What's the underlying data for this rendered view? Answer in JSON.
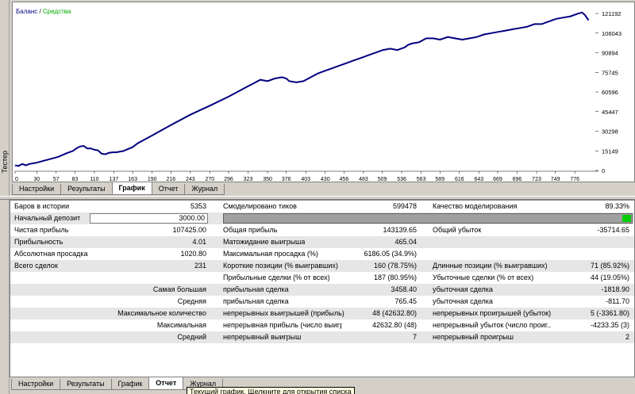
{
  "side_label": "Тестер",
  "chart": {
    "legend_balance": "Баланс",
    "legend_sep": " / ",
    "legend_equity": "Средства",
    "balance_color": "#000080",
    "equity_color": "#00aa00"
  },
  "chart_data": {
    "type": "line",
    "series": [
      {
        "name": "Баланс",
        "x": [
          0,
          5,
          10,
          15,
          20,
          25,
          30,
          40,
          50,
          60,
          70,
          75,
          80,
          85,
          90,
          95,
          100,
          105,
          110,
          115,
          120,
          125,
          130,
          135,
          140,
          150,
          163,
          170,
          190,
          216,
          243,
          270,
          296,
          323,
          330,
          340,
          350,
          360,
          370,
          376,
          380,
          390,
          400,
          410,
          420,
          430,
          440,
          450,
          460,
          470,
          480,
          490,
          500,
          510,
          520,
          530,
          540,
          545,
          550,
          560,
          570,
          580,
          589,
          600,
          610,
          620,
          630,
          640,
          650,
          660,
          670,
          680,
          690,
          700,
          710,
          720,
          730,
          740,
          750,
          760,
          770,
          780,
          786,
          790,
          795
        ],
        "values": [
          4000,
          3500,
          5000,
          4000,
          5000,
          5500,
          6000,
          7500,
          9000,
          10500,
          13000,
          14000,
          15000,
          17000,
          18500,
          19000,
          17000,
          17000,
          16000,
          15500,
          13000,
          12500,
          13500,
          14000,
          14000,
          15000,
          18000,
          21000,
          27000,
          35000,
          43000,
          50000,
          57000,
          65000,
          67000,
          70000,
          69000,
          71000,
          72000,
          71000,
          69000,
          68000,
          69000,
          72000,
          75000,
          77000,
          79000,
          81000,
          83000,
          85000,
          87000,
          89000,
          91000,
          93000,
          94000,
          93000,
          95000,
          97000,
          98000,
          99000,
          102000,
          102000,
          101000,
          103000,
          102000,
          101000,
          102000,
          103000,
          105000,
          106000,
          107000,
          108000,
          109000,
          110000,
          111000,
          113000,
          113000,
          115000,
          117000,
          118000,
          119000,
          121000,
          122000,
          120000,
          116000
        ]
      }
    ],
    "x_ticks": [
      "0",
      "30",
      "57",
      "83",
      "110",
      "137",
      "163",
      "190",
      "216",
      "243",
      "270",
      "296",
      "323",
      "350",
      "376",
      "403",
      "430",
      "456",
      "483",
      "509",
      "536",
      "563",
      "589",
      "616",
      "643",
      "669",
      "696",
      "723",
      "749",
      "776"
    ],
    "y_ticks": [
      "121192",
      "106043",
      "90894",
      "75745",
      "60596",
      "45447",
      "30298",
      "15149",
      "0"
    ],
    "xlim": [
      0,
      800
    ],
    "ylim": [
      0,
      121192
    ]
  },
  "tabs_top": [
    "Настройки",
    "Результаты",
    "График",
    "Отчет",
    "Журнал"
  ],
  "tabs_bottom": [
    "Настройки",
    "Результаты",
    "График",
    "Отчет",
    "Журнал"
  ],
  "report": {
    "r1": {
      "l1": "Баров в истории",
      "v1": "5353",
      "l2": "Смоделировано тиков",
      "v2": "599478",
      "l3": "Качество моделирования",
      "v3": "89.33%"
    },
    "r2": {
      "l1": "Начальный депозит",
      "v1": "3000.00"
    },
    "r3": {
      "l1": "Чистая прибыль",
      "v1": "107425.00",
      "l2": "Общая прибыль",
      "v2": "143139.65",
      "l3": "Общий убыток",
      "v3": "-35714.65"
    },
    "r4": {
      "l1": "Прибыльность",
      "v1": "4.01",
      "l2": "Матожидание выигрыша",
      "v2": "465.04"
    },
    "r5": {
      "l1": "Абсолютная просадка",
      "v1": "1020.80",
      "l2": "Максимальная просадка (%)",
      "v2": "6186.05 (34.9%)"
    },
    "r6": {
      "l1": "Всего сделок",
      "v1": "231",
      "l2": "Короткие позиции (% выигравших)",
      "v2": "160 (78.75%)",
      "l3": "Длинные позиции (% выигравших)",
      "v3": "71 (85.92%)"
    },
    "r7": {
      "l2": "Прибыльные сделки (% от всех)",
      "v2": "187 (80.95%)",
      "l3": "Убыточные сделки (% от всех)",
      "v3": "44 (19.05%)"
    },
    "r8": {
      "l1": "Самая большая",
      "l2": "прибыльная сделка",
      "v2": "3458.40",
      "l3": "убыточная сделка",
      "v3": "-1818.90"
    },
    "r9": {
      "l1": "Средняя",
      "l2": "прибыльная сделка",
      "v2": "765.45",
      "l3": "убыточная сделка",
      "v3": "-811.70"
    },
    "r10": {
      "l1": "Максимальное количество",
      "l2": "непрерывных выигрышей (прибыль)",
      "v2": "48 (42632.80)",
      "l3": "непрерывных проигрышей (убыток)",
      "v3": "5 (-3361.80)"
    },
    "r11": {
      "l1": "Максимальная",
      "l2": "непрерывная прибыль (число выигр...",
      "v2": "42632.80 (48)",
      "l3": "непрерывный убыток (число проиг...",
      "v3": "-4233.35 (3)"
    },
    "r12": {
      "l1": "Средний",
      "l2": "непрерывный выигрыш",
      "v2": "7",
      "l3": "непрерывный проигрыш",
      "v3": "2"
    }
  },
  "tooltip": "Текущий график. Щелкните для открытия списка"
}
